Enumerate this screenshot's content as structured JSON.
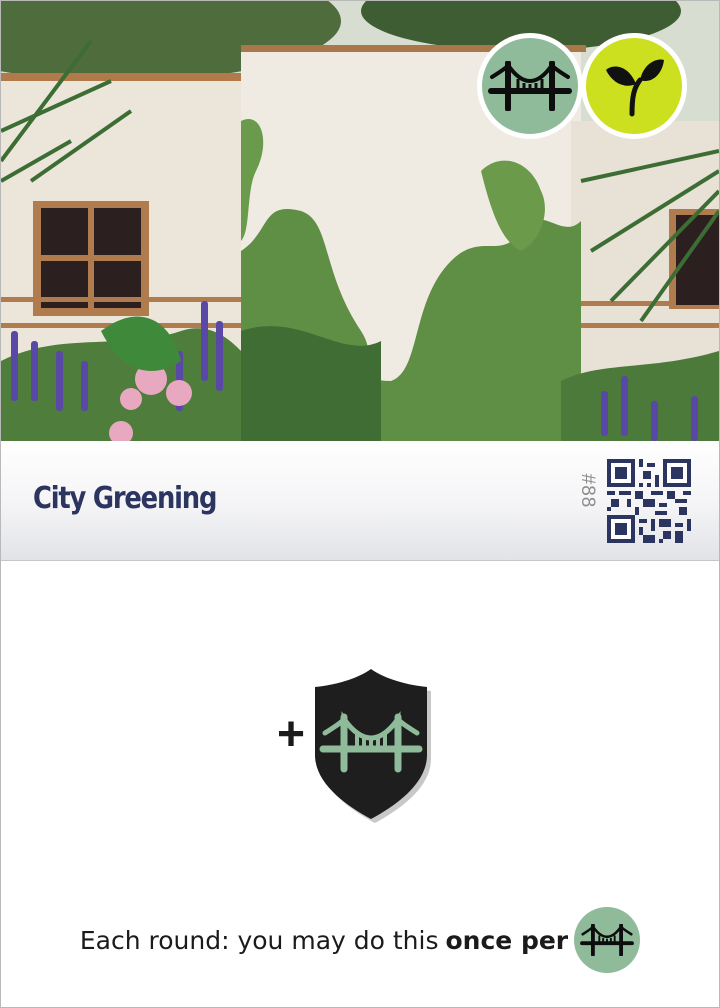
{
  "card": {
    "title": "City Greening",
    "number": "#88",
    "rule_text": "Each round: you may do this",
    "rule_emphasis": "once per",
    "effect_prefix": "+"
  },
  "tags": [
    {
      "icon": "bridge-icon",
      "bg": "#8fbb9a"
    },
    {
      "icon": "sprout-icon",
      "bg": "#cde01f"
    }
  ],
  "colors": {
    "title": "#2c3560",
    "shield": "#1e1e1e",
    "bridge_green": "#8fbb9a",
    "qr": "#2c3560"
  }
}
